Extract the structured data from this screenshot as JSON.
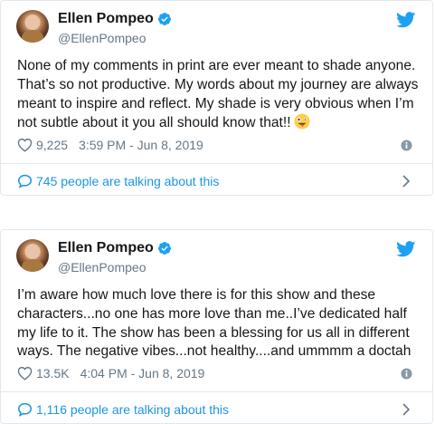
{
  "tweets": [
    {
      "name": "Ellen Pompeo",
      "handle": "@EllenPompeo",
      "text": "None of my comments in print are ever meant to shade anyone. That’s so not productive.  My words about my journey are always meant to inspire and reflect.  My shade is very obvious when I’m not subtle about it you all should know that!!",
      "emoji": "zany-face",
      "likes": "9,225",
      "timestamp": "3:59 PM - Jun 8, 2019",
      "talking": "745 people are talking about this"
    },
    {
      "name": "Ellen Pompeo",
      "handle": "@EllenPompeo",
      "text": "I’m aware how much love there is for this show and these characters...no one has more love than me..I’ve dedicated half my life to it. The show has been a blessing for us all in different ways. The negative vibes...not healthy....and ummmm a doctah",
      "likes": "13.5K",
      "timestamp": "4:04 PM - Jun 8, 2019",
      "talking": "1,116 people are talking about this"
    }
  ],
  "colors": {
    "link": "#1b95e0",
    "muted": "#657786",
    "border": "#e1e8ed",
    "verified": "#1da1f2"
  },
  "icons": [
    "avatar",
    "verified-badge-icon",
    "twitter-bird-icon",
    "heart-icon",
    "info-icon",
    "comment-bubble-icon",
    "chevron-right-icon",
    "zany-face-emoji"
  ]
}
